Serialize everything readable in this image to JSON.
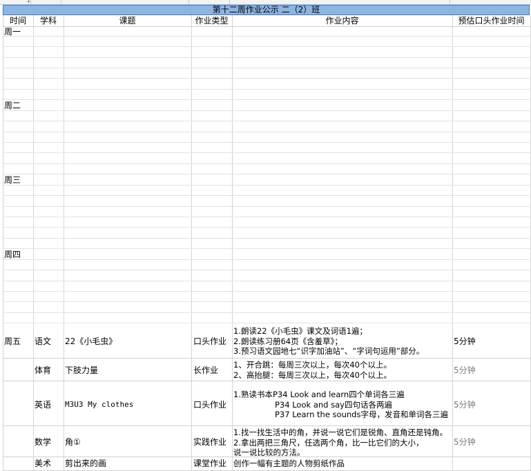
{
  "sheet": {
    "title": "第十二周作业公示 二（2）班",
    "headers": [
      "时间",
      "学科",
      "课题",
      "作业类型",
      "作业内容",
      "预估口头作业时间"
    ],
    "days": [
      "周一",
      "周二",
      "周三",
      "周四"
    ],
    "friday": {
      "day": "周五",
      "rows": [
        {
          "subject": "语文",
          "topic": "22《小毛虫》",
          "type": "口头作业",
          "content": [
            "1.朗读22《小毛虫》课文及词语1遍；",
            "2.朗读练习册64页《含羞草》；",
            "3.预习语文园地七“识字加油站”、“字词句运用”部分。"
          ],
          "time": "5分钟"
        },
        {
          "subject": "体育",
          "topic": "下肢力量",
          "type": "长作业",
          "content": [
            "1、开合跳：每周三次以上，每次40个以上。",
            "2、高抬腿：每周三次以上，每次40个以上。"
          ],
          "time": "5分钟"
        },
        {
          "subject": "英语",
          "topic": "M3U3 My clothes",
          "type": "口头作业",
          "content": [
            "1.熟读书本P34 Look and learn四个单词各三遍",
            "P34 Look and say四句话各两遍",
            "P37 Learn the sounds字母，发音和单词各三遍"
          ],
          "time": "5分钟"
        },
        {
          "subject": "数学",
          "topic": "角①",
          "type": "实践作业",
          "content": [
            "1.找一找生活中的角，并说一说它们是锐角、直角还是钝角。",
            "2.拿出两把三角尺，任选两个角，比一比它们的大小，",
            "说一说比较的方法。"
          ],
          "time": "5分钟"
        },
        {
          "subject": "美术",
          "topic": "剪出来的画",
          "type": "课堂作业",
          "content": [
            "创作一幅有主题的人物剪纸作品"
          ],
          "time": ""
        }
      ]
    }
  }
}
